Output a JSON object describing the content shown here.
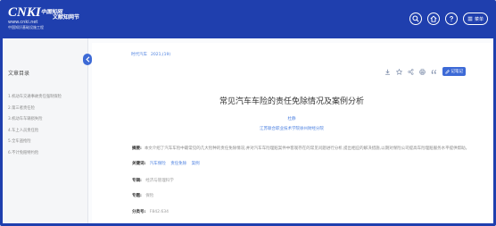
{
  "header": {
    "logo_brand": "CNKI",
    "logo_brand_cn": "中国知网",
    "logo_url": "www.cnki.net",
    "logo_sub": "中国知识基础设施工程",
    "site_name": "文献知网节",
    "buttons": {
      "search_icon": "search-icon",
      "home_icon": "home-icon",
      "help_icon": "help-icon",
      "menu_label": "菜单"
    }
  },
  "sidebar": {
    "title": "文章目录",
    "items": [
      "1.机动车交通事故责任强制保险",
      "2.第三者责任险",
      "3.机动车车辆损失险",
      "4.车上人员责任险",
      "5.全车盗抢险",
      "6.不计免赔特约险"
    ]
  },
  "main": {
    "journal": "时代汽车",
    "issue": "2021,(19)",
    "tools": [
      "download-icon",
      "star-icon",
      "share-icon",
      "print-icon",
      "quote-icon"
    ],
    "record_label": "记笔记",
    "title": "常见汽车车险的责任免除情况及案例分析",
    "author": "杜静",
    "affiliation": "江苏联合职业技术学院徐州财经分院",
    "abstract_label": "摘要:",
    "abstract_text": "本文介绍了汽车车险中最常见的几大险种的责任免除情况,并对汽车车险理赔案件中客观存在的常见问题进行分析,提出相应的解决措施,以期对保险公司提高车险理赔服务水平提供帮助。",
    "keywords_label": "关键词:",
    "keywords": [
      "汽车保险",
      "责任免除",
      "案例"
    ],
    "topic_label": "专辑:",
    "topic_value": "经济与管理科学",
    "subject_label": "专题:",
    "subject_value": "保险",
    "class_label": "分类号:",
    "class_value": "F842.634"
  },
  "colors": {
    "header_bg": "#1f3fae",
    "accent": "#4a7fe0",
    "button_blue": "#3d6ad6"
  }
}
